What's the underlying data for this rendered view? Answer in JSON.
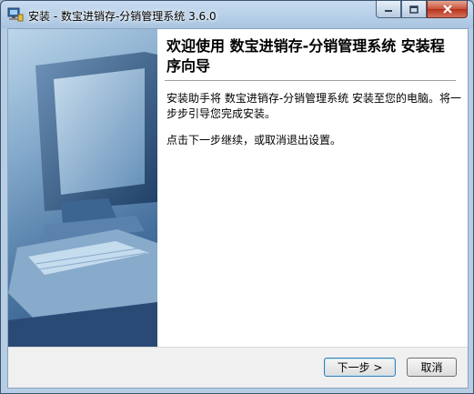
{
  "window": {
    "title": "安装 - 数宝进销存-分销管理系统 3.6.0"
  },
  "content": {
    "heading": "欢迎使用 数宝进销存-分销管理系统 安装程序向导",
    "paragraph1": "安装助手将 数宝进销存-分销管理系统 安装至您的电脑。将一步步引导您完成安装。",
    "paragraph2": "点击下一步继续，或取消退出设置。"
  },
  "buttons": {
    "next_label": "下一步 >",
    "cancel_label": "取消"
  },
  "icons": {
    "app": "installer-icon",
    "minimize": "minimize-icon",
    "maximize": "maximize-icon",
    "close": "close-icon"
  },
  "colors": {
    "title_bar": "#a9c4e0",
    "close_button": "#c7533b",
    "sidebar_blue": "#456f9c"
  }
}
